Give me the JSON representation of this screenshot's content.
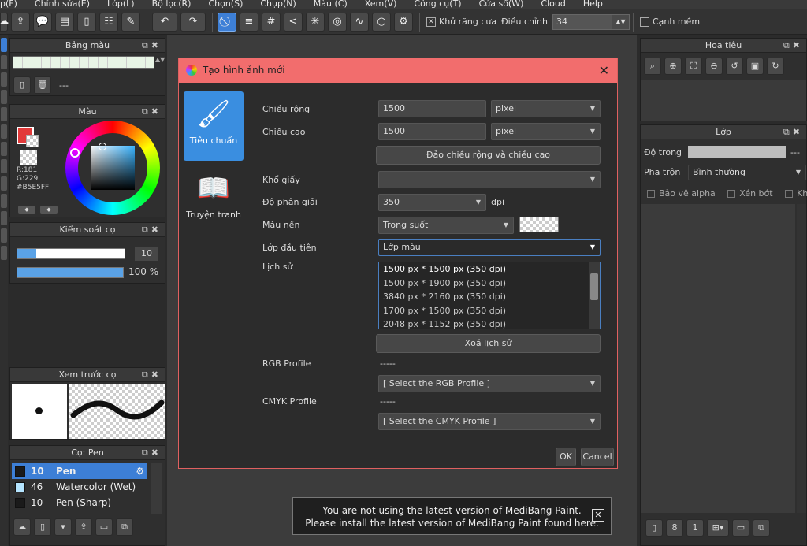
{
  "menu": [
    "p(F)",
    "Chỉnh sửa(E)",
    "Lớp(L)",
    "Bộ lọc(R)",
    "Chọn(S)",
    "Chụp(N)",
    "Màu (C)",
    "Xem(V)",
    "Công cụ(T)",
    "Cửa sổ(W)",
    "Cloud",
    "Help"
  ],
  "toolbar": {
    "antialias_label": "Khử răng cưa",
    "antialias_checked": "✕",
    "adjust_label": "Điều chỉnh",
    "adjust_value": "34",
    "smooth_label": "Cạnh mềm"
  },
  "palette_panel": {
    "title": "Bảng màu",
    "name": "---"
  },
  "color_panel": {
    "title": "Màu",
    "r": "R:181",
    "g": "G:229",
    "hex": "#B5E5FF"
  },
  "brush_control": {
    "title": "Kiểm soát cọ",
    "size": "10",
    "opacity": "100 %"
  },
  "brush_preview": {
    "title": "Xem trước cọ"
  },
  "brush_list": {
    "title": "Cọ: Pen",
    "items": [
      {
        "size": "10",
        "name": "Pen",
        "color": "#1a1a1a"
      },
      {
        "size": "46",
        "name": "Watercolor (Wet)",
        "color": "#b5e5ff"
      },
      {
        "size": "10",
        "name": "Pen (Sharp)",
        "color": "#1a1a1a"
      }
    ]
  },
  "navigator": {
    "title": "Hoa tiêu"
  },
  "layers": {
    "title": "Lớp",
    "opacity_label": "Độ trong",
    "opacity_value": "---",
    "blend_label": "Pha trộn",
    "blend_value": "Bình thường",
    "protect_alpha": "Bảo vệ alpha",
    "clip": "Xén bớt",
    "lock": "Khóa"
  },
  "dialog": {
    "title": "Tạo hình ảnh mới",
    "categories": [
      "Tiêu chuẩn",
      "Truyện tranh"
    ],
    "width_label": "Chiều rộng",
    "width_value": "1500",
    "width_unit": "pixel",
    "height_label": "Chiều cao",
    "height_value": "1500",
    "height_unit": "pixel",
    "swap_button": "Đảo chiều rộng và chiều cao",
    "paper_label": "Khổ giấy",
    "paper_value": "",
    "resolution_label": "Độ phân giải",
    "resolution_value": "350",
    "resolution_unit": "dpi",
    "bg_label": "Màu nền",
    "bg_value": "Trong suốt",
    "first_layer_label": "Lớp đầu tiên",
    "first_layer_value": "Lớp màu",
    "history_label": "Lịch sử",
    "history": [
      "1500 px * 1500 px (350 dpi)",
      "1500 px * 1900 px (350 dpi)",
      "3840 px * 2160 px (350 dpi)",
      "1700 px * 1500 px (350 dpi)",
      "2048 px * 1152 px (350 dpi)"
    ],
    "clear_history_button": "Xoá lịch sử",
    "rgb_label": "RGB Profile",
    "rgb_status": "-----",
    "rgb_value": "[ Select the RGB Profile ]",
    "cmyk_label": "CMYK Profile",
    "cmyk_status": "-----",
    "cmyk_value": "[ Select the CMYK Profile ]",
    "ok_button": "OK",
    "cancel_button": "Cancel"
  },
  "notice": {
    "line1": "You are not using the latest version of MediBang Paint.",
    "line2": "Please install the latest version of MediBang Paint found here.",
    "close": "✕"
  },
  "colors": {
    "accent": "#3d7fd6",
    "dialog_header": "#f26d6d",
    "fg_color": "#e23a3a",
    "secondary_color": "#b5e5ff"
  }
}
